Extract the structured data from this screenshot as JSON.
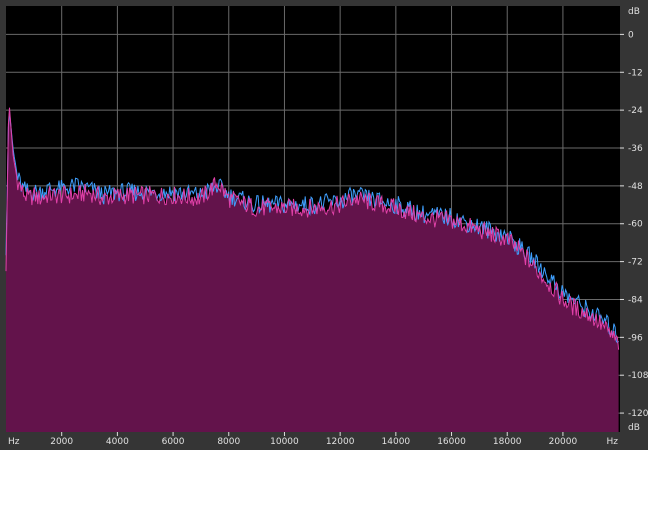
{
  "chart_data": {
    "type": "area",
    "title": "",
    "xlabel": "",
    "ylabel": "",
    "x_unit": "Hz",
    "y_unit": "dB",
    "xlim": [
      0,
      22050
    ],
    "ylim": [
      -126,
      9
    ],
    "x_ticks": [
      2000,
      4000,
      6000,
      8000,
      10000,
      12000,
      14000,
      16000,
      18000,
      20000
    ],
    "y_ticks": [
      0,
      -12,
      -24,
      -36,
      -48,
      -60,
      -72,
      -84,
      -96,
      -108,
      -120
    ],
    "grid": true,
    "colors": {
      "plot_background": "#000000",
      "frame": "#353535",
      "grid": "#6a6a6a",
      "fill": "#63134b",
      "series_left": "#e040a8",
      "series_right": "#3fa0ff",
      "axis_text": "#e0e0e0"
    },
    "x": [
      0,
      100,
      250,
      400,
      600,
      800,
      1000,
      1200,
      1500,
      2000,
      2500,
      3000,
      3500,
      4000,
      5000,
      6000,
      7000,
      7600,
      8000,
      9000,
      10000,
      11000,
      12000,
      12500,
      13000,
      14000,
      15000,
      16000,
      17000,
      18000,
      18500,
      19000,
      19500,
      20000,
      20500,
      21000,
      21500,
      22000
    ],
    "series": [
      {
        "values": [
          -75,
          -20,
          -38,
          -46,
          -50,
          -52,
          -51,
          -52,
          -51,
          -51,
          -51,
          -50,
          -52,
          -51,
          -51,
          -51,
          -52,
          -47,
          -52,
          -55,
          -55,
          -55,
          -54,
          -52,
          -53,
          -55,
          -58,
          -59,
          -62,
          -65,
          -69,
          -74,
          -79,
          -84,
          -87,
          -89,
          -93,
          -98
        ]
      },
      {
        "values": [
          -70,
          -22,
          -36,
          -45,
          -49,
          -50,
          -50,
          -50,
          -49,
          -49,
          -48,
          -49,
          -51,
          -50,
          -50,
          -50,
          -51,
          -48,
          -51,
          -54,
          -54,
          -54,
          -53,
          -51,
          -52,
          -54,
          -57,
          -58,
          -61,
          -64,
          -68,
          -72,
          -77,
          -82,
          -85,
          -88,
          -91,
          -96
        ]
      }
    ]
  }
}
